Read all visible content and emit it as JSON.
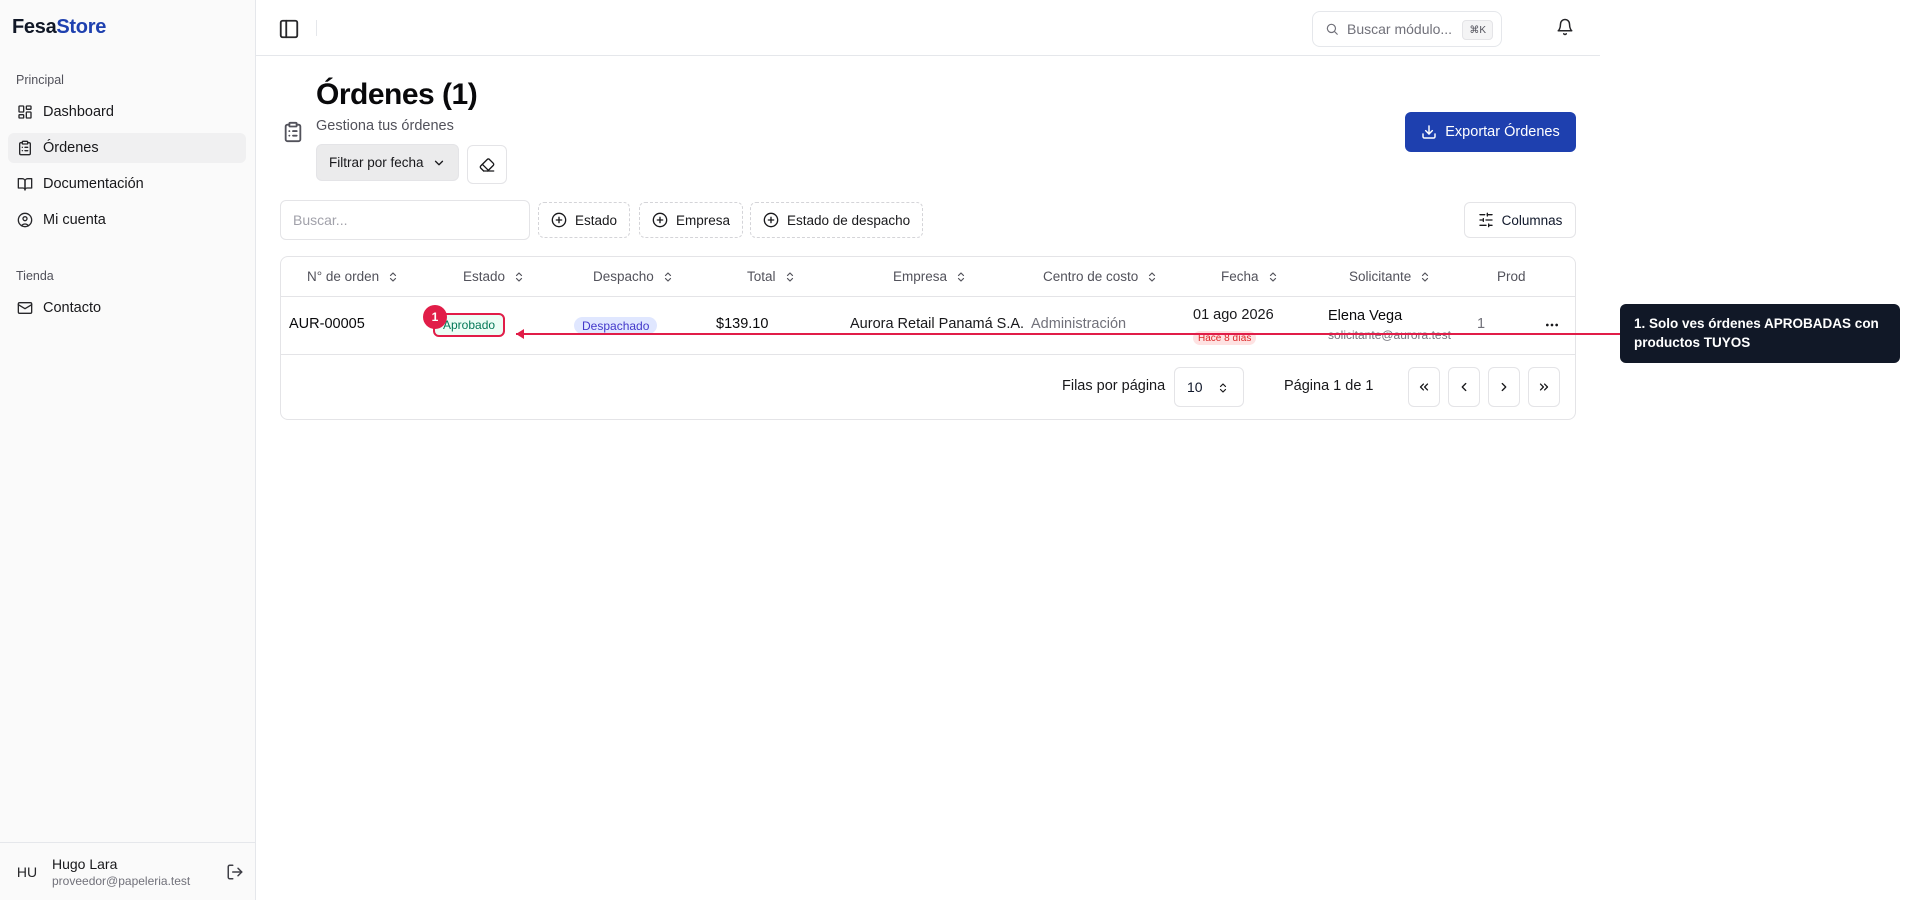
{
  "brand": {
    "part1": "Fesa",
    "part2": "Store"
  },
  "sidebar": {
    "group_principal": "Principal",
    "group_tienda": "Tienda",
    "items": [
      {
        "label": "Dashboard",
        "icon": "dashboard-icon"
      },
      {
        "label": "Órdenes",
        "icon": "clipboard-icon",
        "active": true
      },
      {
        "label": "Documentación",
        "icon": "book-icon"
      },
      {
        "label": "Mi cuenta",
        "icon": "user-circle-icon"
      },
      {
        "label": "Contacto",
        "icon": "mail-icon"
      }
    ],
    "user": {
      "initials": "HU",
      "name": "Hugo Lara",
      "email": "proveedor@papeleria.test"
    }
  },
  "header": {
    "search_placeholder": "Buscar módulo...",
    "shortcut": "⌘K"
  },
  "page": {
    "title": "Órdenes (1)",
    "subtitle": "Gestiona tus órdenes",
    "date_filter_label": "Filtrar por fecha",
    "export_label": "Exportar Órdenes"
  },
  "filters": {
    "search_placeholder": "Buscar...",
    "chips": [
      "Estado",
      "Empresa",
      "Estado de despacho"
    ],
    "columns_label": "Columnas"
  },
  "table": {
    "headers": [
      "N° de orden",
      "Estado",
      "Despacho",
      "Total",
      "Empresa",
      "Centro de costo",
      "Fecha",
      "Solicitante",
      "Prod"
    ],
    "rows": [
      {
        "order": "AUR-00005",
        "estado": "Aprobado",
        "despacho": "Despachado",
        "total": "$139.10",
        "empresa": "Aurora Retail Panamá S.A.",
        "centro": "Administración",
        "fecha": "01 ago 2026",
        "fecha_rel": "Hace 8 días",
        "solicitante": "Elena Vega",
        "solicitante_email": "solicitante@aurora.test",
        "prod": "1"
      }
    ]
  },
  "pagination": {
    "rows_label": "Filas por página",
    "rows_value": "10",
    "page_label": "Página 1 de 1"
  },
  "tour": {
    "step": "1",
    "text": "1. Solo ves órdenes APROBADAS con productos TUYOS",
    "color": "#e11d48"
  },
  "colors": {
    "brand": "#1e40af",
    "accent_red": "#e11d48",
    "tooltip_bg": "#111827"
  }
}
